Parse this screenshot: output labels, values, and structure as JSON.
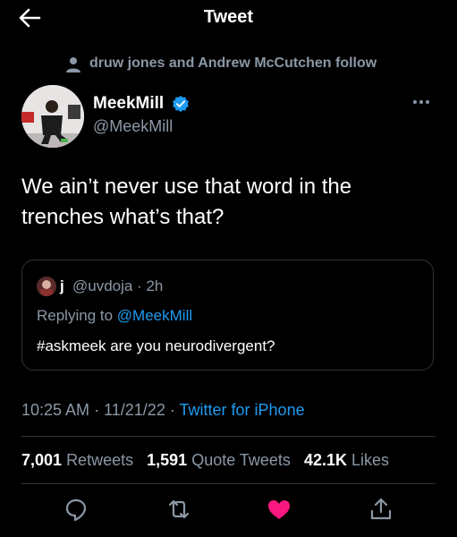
{
  "header": {
    "title": "Tweet",
    "back_icon": "arrow-left-icon"
  },
  "social_context": {
    "icon": "person-icon",
    "text": "druw jones and Andrew McCutchen follow"
  },
  "author": {
    "name": "MeekMill",
    "handle": "@MeekMill",
    "verified_icon": "verified-badge-icon"
  },
  "tweet": {
    "text": "We ain’t never use that word in the trenches what’s that?"
  },
  "quote": {
    "name": "j",
    "handle_time": "@uvdoja · 2h",
    "replying_prefix": "Replying to",
    "replying_handle": "@MeekMill",
    "text": "#askmeek are you neurodivergent?"
  },
  "meta": {
    "time": "10:25 AM",
    "separator": "·",
    "date": "11/21/22",
    "source": "Twitter for iPhone"
  },
  "stats": {
    "retweets_count": "7,001",
    "retweets_label": "Retweets",
    "quotes_count": "1,591",
    "quotes_label": "Quote Tweets",
    "likes_count": "42.1K",
    "likes_label": "Likes"
  },
  "actions": [
    "reply-icon",
    "retweet-icon",
    "like-icon",
    "share-icon"
  ],
  "colors": {
    "background": "#000000",
    "accent": "#1d9bf0",
    "like": "#f91880",
    "muted": "#8b98a5"
  }
}
